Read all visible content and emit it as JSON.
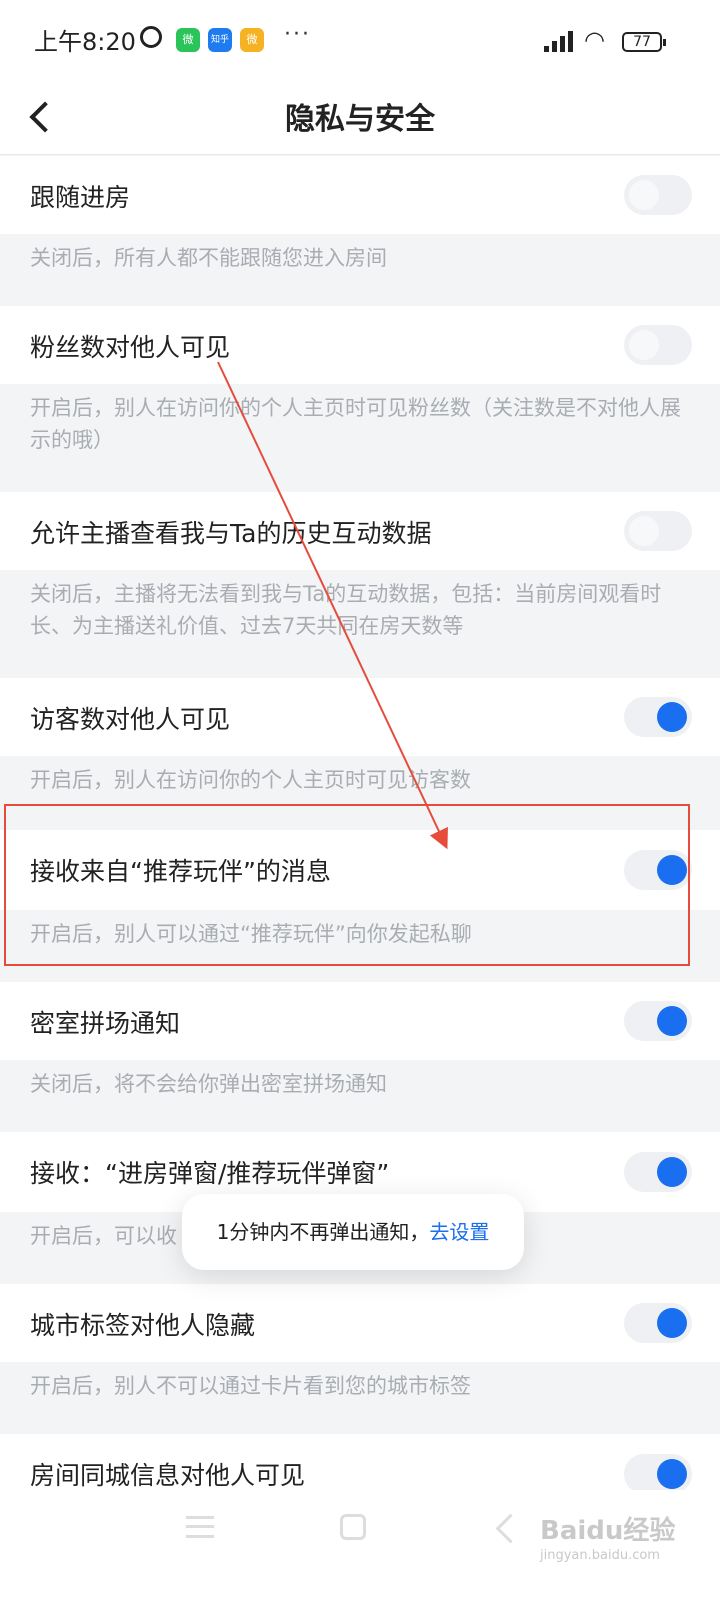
{
  "status_bar": {
    "time": "上午8:20",
    "notif_app1": "微",
    "notif_app2": "知乎",
    "notif_app3": "微",
    "overflow": "···",
    "battery": "77"
  },
  "header": {
    "title": "隐私与安全"
  },
  "settings": [
    {
      "label": "跟随进房",
      "desc": "关闭后，所有人都不能跟随您进入房间",
      "on": false
    },
    {
      "label": "粉丝数对他人可见",
      "desc": "开启后，别人在访问你的个人主页时可见粉丝数（关注数是不对他人展示的哦）",
      "on": false
    },
    {
      "label": "允许主播查看我与Ta的历史互动数据",
      "desc": "关闭后，主播将无法看到我与Ta的互动数据，包括：当前房间观看时长、为主播送礼价值、过去7天共同在房天数等",
      "on": false
    },
    {
      "label": "访客数对他人可见",
      "desc": "开启后，别人在访问你的个人主页时可见访客数",
      "on": true
    },
    {
      "label": "接收来自“推荐玩伴”的消息",
      "desc": "开启后，别人可以通过“推荐玩伴”向你发起私聊",
      "on": true
    },
    {
      "label": "密室拼场通知",
      "desc": "关闭后，将不会给你弹出密室拼场通知",
      "on": true
    },
    {
      "label": "接收：“进房弹窗/推荐玩伴弹窗”",
      "desc": "开启后，可以收",
      "on": true
    },
    {
      "label": "城市标签对他人隐藏",
      "desc": "开启后，别人不可以通过卡片看到您的城市标签",
      "on": true
    },
    {
      "label": "房间同城信息对他人可见",
      "desc": "",
      "on": true
    }
  ],
  "toast": {
    "text": "1分钟内不再弹出通知，",
    "link": "去设置"
  },
  "watermark": {
    "brand": "Baidu经验",
    "url": "jingyan.baidu.com"
  },
  "colors": {
    "accent": "#1a6ef0",
    "annotation": "#e64b3b"
  }
}
